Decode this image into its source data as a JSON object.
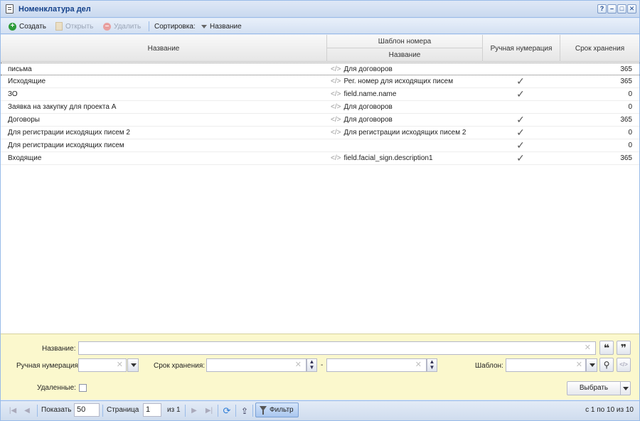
{
  "window": {
    "title": "Номенклатура дел",
    "tools": [
      "?",
      "–",
      "□",
      "✕"
    ]
  },
  "toolbar": {
    "create_label": "Создать",
    "open_label": "Открыть",
    "delete_label": "Удалить",
    "sort_label": "Сортировка:",
    "sort_field_label": "Название"
  },
  "grid": {
    "headers": {
      "name": "Название",
      "template_group": "Шаблон номера",
      "template_name": "Название",
      "manual_numbering": "Ручная нумерация",
      "retention": "Срок хранения"
    },
    "rows": [
      {
        "name": "письма",
        "template": "Для договоров",
        "manual": "",
        "retention": "365"
      },
      {
        "name": "Исходящие",
        "template": "Рег. номер для исходящих писем",
        "manual": "✓",
        "retention": "365"
      },
      {
        "name": "ЗО",
        "template": "field.name.name",
        "manual": "✓",
        "retention": "0"
      },
      {
        "name": "Заявка на закупку для проекта А",
        "template": "Для договоров",
        "manual": "",
        "retention": "0"
      },
      {
        "name": "Договоры",
        "template": "Для договоров",
        "manual": "✓",
        "retention": "365"
      },
      {
        "name": "Для регистрации исходящих писем 2",
        "template": "Для регистрации исходящих писем 2",
        "manual": "✓",
        "retention": "0"
      },
      {
        "name": "Для регистрации исходящих писем",
        "template": "",
        "manual": "✓",
        "retention": "0"
      },
      {
        "name": "Входящие",
        "template": "field.facial_sign.description1",
        "manual": "✓",
        "retention": "365"
      }
    ],
    "template_code_glyph": "</>"
  },
  "filter": {
    "name_label": "Название:",
    "name_value": "",
    "manual_label": "Ручная нумерация",
    "manual_value": "",
    "retention_label": "Срок хранения:",
    "retention_from": "",
    "retention_to": "",
    "range_dash": "-",
    "template_label": "Шаблон:",
    "template_value": "",
    "deleted_label": "Удаленные:",
    "select_button": "Выбрать",
    "quote_open_glyph": "❝",
    "quote_close_glyph": "❞",
    "code_glyph": "</>"
  },
  "pager": {
    "show_label": "Показать",
    "page_size": "50",
    "page_label": "Страница",
    "page_value": "1",
    "of_label": "из 1",
    "filter_button": "Фильтр",
    "summary": "с 1 по 10 из 10"
  },
  "colors": {
    "title_text": "#15428b",
    "filter_bg": "#fbf8cd",
    "add_icon": "#2d9b3a"
  }
}
